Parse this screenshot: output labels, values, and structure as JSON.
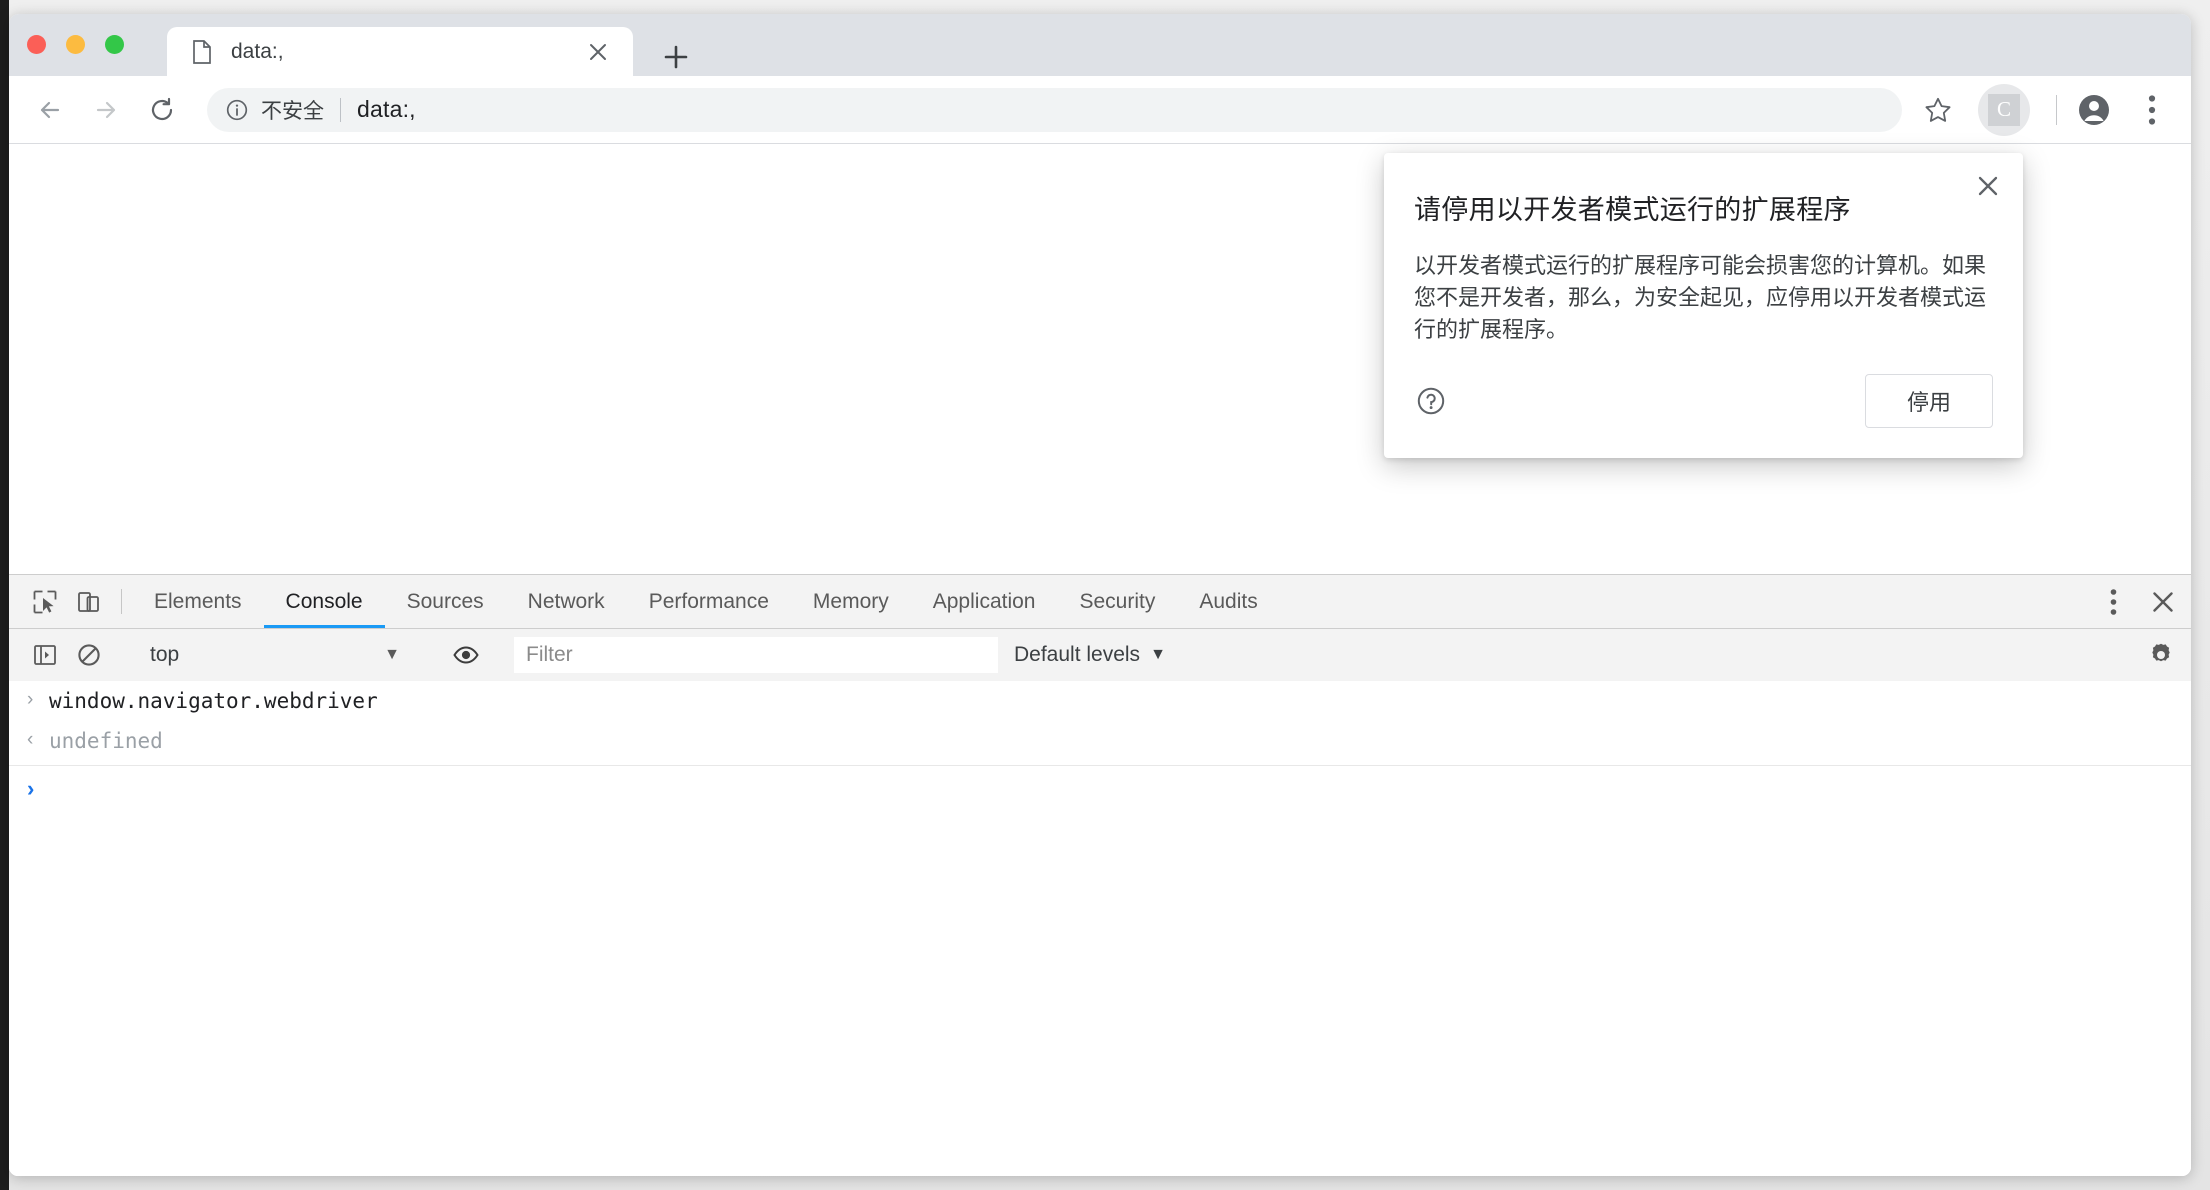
{
  "window": {
    "traffic_lights": [
      "close",
      "minimize",
      "maximize"
    ]
  },
  "tabstrip": {
    "active_tab": {
      "title": "data:,",
      "favicon": "document-icon",
      "close_icon": "close-icon"
    },
    "new_tab_label": "+"
  },
  "toolbar": {
    "back_icon": "back-arrow-icon",
    "forward_icon": "forward-arrow-icon",
    "reload_icon": "reload-icon",
    "security_icon": "info-circle-icon",
    "security_text": "不安全",
    "url": "data:,",
    "bookmark_icon": "star-icon",
    "extension_badge": "C",
    "profile_icon": "account-circle-icon",
    "menu_icon": "three-dot-menu-icon"
  },
  "dialog": {
    "title": "请停用以开发者模式运行的扩展程序",
    "body": "以开发者模式运行的扩展程序可能会损害您的计算机。如果您不是开发者，那么，为安全起见，应停用以开发者模式运行的扩展程序。",
    "close_icon": "close-icon",
    "help_icon": "help-circle-icon",
    "action_label": "停用"
  },
  "devtools": {
    "inspect_icon": "inspect-cursor-icon",
    "device_toolbar_icon": "device-toggle-icon",
    "tabs": [
      {
        "label": "Elements",
        "active": false
      },
      {
        "label": "Console",
        "active": true
      },
      {
        "label": "Sources",
        "active": false
      },
      {
        "label": "Network",
        "active": false
      },
      {
        "label": "Performance",
        "active": false
      },
      {
        "label": "Memory",
        "active": false
      },
      {
        "label": "Application",
        "active": false
      },
      {
        "label": "Security",
        "active": false
      },
      {
        "label": "Audits",
        "active": false
      }
    ],
    "more_icon": "three-dot-menu-icon",
    "close_icon": "close-icon",
    "console_toolbar": {
      "sidebar_toggle_icon": "console-sidebar-icon",
      "clear_icon": "clear-console-icon",
      "context": "top",
      "context_caret": "▼",
      "eye_icon": "live-expression-eye-icon",
      "filter_value": "",
      "filter_placeholder": "Filter",
      "levels": "Default levels",
      "levels_caret": "▼",
      "settings_icon": "gear-icon"
    },
    "console_log": [
      {
        "gutter": "›",
        "text": "window.navigator.webdriver",
        "kind": "input"
      },
      {
        "gutter": "‹",
        "text": "undefined",
        "kind": "output"
      }
    ],
    "prompt_caret": "❯"
  },
  "colors": {
    "accent_blue": "#1a9af5",
    "prompt_blue": "#1a73e8",
    "tabstrip_bg": "#dee1e6",
    "devtools_bg": "#f3f3f3",
    "insecure_text": "#3c4043"
  }
}
